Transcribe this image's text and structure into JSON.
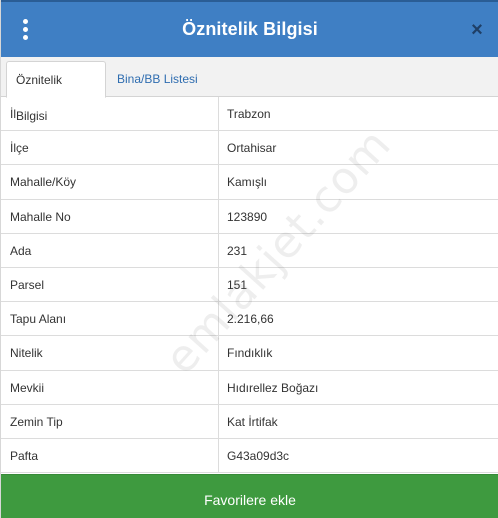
{
  "window": {
    "title": "Öznitelik Bilgisi",
    "close_symbol": "×",
    "menu_icon": "vertical-dots-icon"
  },
  "tabs": [
    {
      "label": "Öznitelik Bilgisi",
      "active": true
    },
    {
      "label": "Bina/BB Listesi",
      "active": false
    }
  ],
  "rows": [
    {
      "key": "İl",
      "value": "Trabzon"
    },
    {
      "key": "İlçe",
      "value": "Ortahisar"
    },
    {
      "key": "Mahalle/Köy",
      "value": "Kamışlı"
    },
    {
      "key": "Mahalle No",
      "value": "123890"
    },
    {
      "key": "Ada",
      "value": "231"
    },
    {
      "key": "Parsel",
      "value": "151"
    },
    {
      "key": "Tapu Alanı",
      "value": "2.216,66"
    },
    {
      "key": "Nitelik",
      "value": "Fındıklık"
    },
    {
      "key": "Mevkii",
      "value": "Hıdırellez Boğazı"
    },
    {
      "key": "Zemin Tip",
      "value": "Kat İrtifak"
    },
    {
      "key": "Pafta",
      "value": "G43a09d3c"
    }
  ],
  "watermark": "emlakjet.com",
  "footer": {
    "button_label": "Favorilere ekle"
  },
  "colors": {
    "header": "#3f7fc4",
    "tab_link": "#2f6db0",
    "footer_button": "#3e9a3f"
  }
}
